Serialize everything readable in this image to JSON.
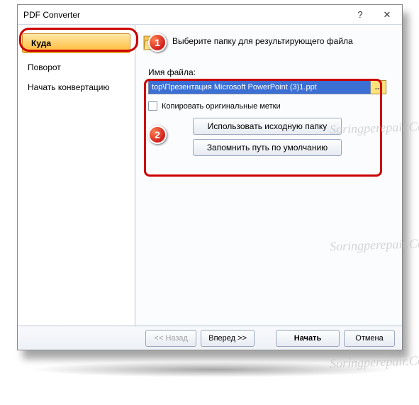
{
  "window": {
    "title": "PDF Converter",
    "help": "?",
    "close": "✕"
  },
  "sidebar": {
    "items": [
      {
        "label": "Куда",
        "selected": true
      },
      {
        "label": "Поворот",
        "selected": false
      },
      {
        "label": "Начать конвертацию",
        "selected": false
      }
    ]
  },
  "content": {
    "prompt": "Выберите папку для результирующего файла",
    "filename_label": "Имя файла:",
    "filename_value": "top\\Презентация Microsoft PowerPoint (3)1.ppt",
    "browse": "...",
    "copy_original_marks": "Копировать оригинальные метки",
    "use_source_folder": "Использовать исходную папку",
    "remember_default_path": "Запомнить путь по умолчанию"
  },
  "footer": {
    "back": "<< Назад",
    "forward": "Вперед >>",
    "start": "Начать",
    "cancel": "Отмена"
  },
  "annotations": {
    "badge1": "1",
    "badge2": "2"
  },
  "watermark": "Soringperepair.Com"
}
